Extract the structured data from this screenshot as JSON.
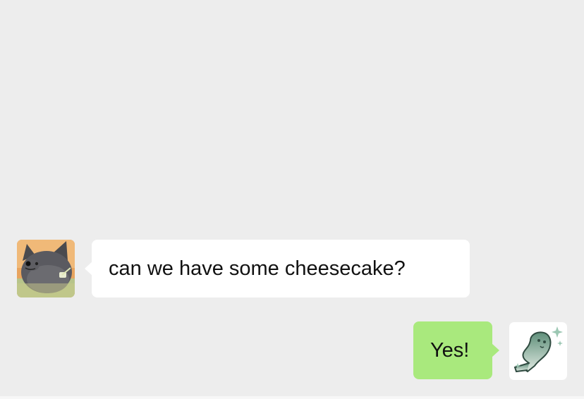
{
  "chat": {
    "messages": [
      {
        "sender": "other",
        "avatar_icon": "cartoon-cat-avatar-icon",
        "text": "can we have some cheesecake?"
      },
      {
        "sender": "self",
        "avatar_icon": "sparkle-creature-avatar-icon",
        "text": "Yes!"
      }
    ]
  },
  "colors": {
    "background": "#ededed",
    "incoming_bubble": "#ffffff",
    "outgoing_bubble": "#a9e97d",
    "text": "#111111"
  }
}
